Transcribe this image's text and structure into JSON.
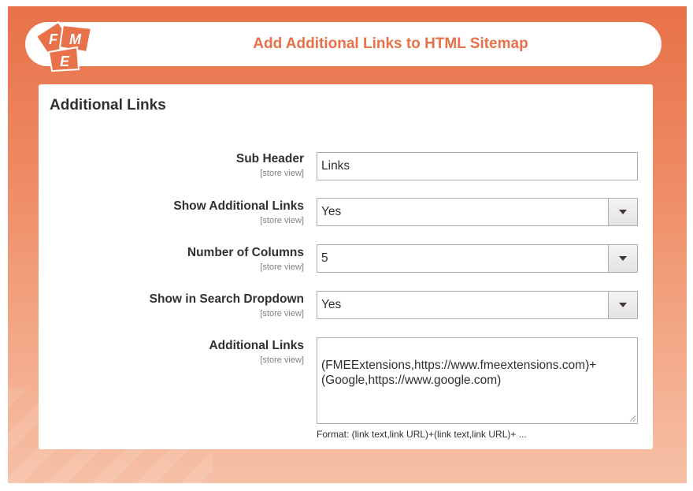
{
  "header": {
    "logo_text": "FME",
    "title": "Add Additional Links to HTML Sitemap"
  },
  "panel": {
    "title": "Additional Links"
  },
  "fields": {
    "sub_header": {
      "label": "Sub Header",
      "scope": "[store view]",
      "value": "Links"
    },
    "show_additional_links": {
      "label": "Show Additional Links",
      "scope": "[store view]",
      "value": "Yes"
    },
    "number_of_columns": {
      "label": "Number of Columns",
      "scope": "[store view]",
      "value": "5"
    },
    "show_in_search_dropdown": {
      "label": "Show in Search Dropdown",
      "scope": "[store view]",
      "value": "Yes"
    },
    "additional_links": {
      "label": "Additional Links",
      "scope": "[store view]",
      "value": "(FMEExtensions,https://www.fmeextensions.com)+\n(Google,https://www.google.com)",
      "note": "Format: (link text,link URL)+(link text,link URL)+ ..."
    }
  },
  "colors": {
    "accent": "#e8714a",
    "text": "#303030",
    "border": "#adadad"
  }
}
